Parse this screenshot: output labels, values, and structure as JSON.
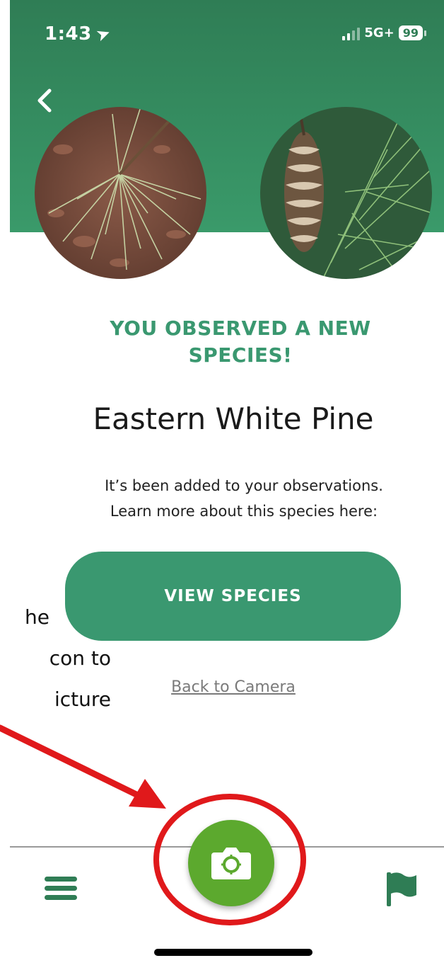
{
  "status_bar": {
    "time": "1:43",
    "network": "5G+",
    "battery": "99"
  },
  "colors": {
    "header_green": "#2f7d55",
    "accent_green": "#3a9870",
    "camera_green": "#5ca92e",
    "annotation_red": "#e0191b"
  },
  "icons": {
    "back": "chevron-left-icon",
    "location": "location-arrow-icon",
    "menu": "menu-icon",
    "camera": "camera-icon",
    "flag": "flag-icon"
  },
  "main": {
    "headline_line1": "YOU OBSERVED A NEW",
    "headline_line2": "SPECIES!",
    "species_name": "Eastern White Pine",
    "description_line1": "It’s been added to your observations.",
    "description_line2": "Learn more about this species here:",
    "view_species_label": "VIEW SPECIES",
    "back_to_camera_label": "Back to Camera"
  },
  "annotation": {
    "line1": "he",
    "line2": "con to",
    "line3": "icture"
  }
}
